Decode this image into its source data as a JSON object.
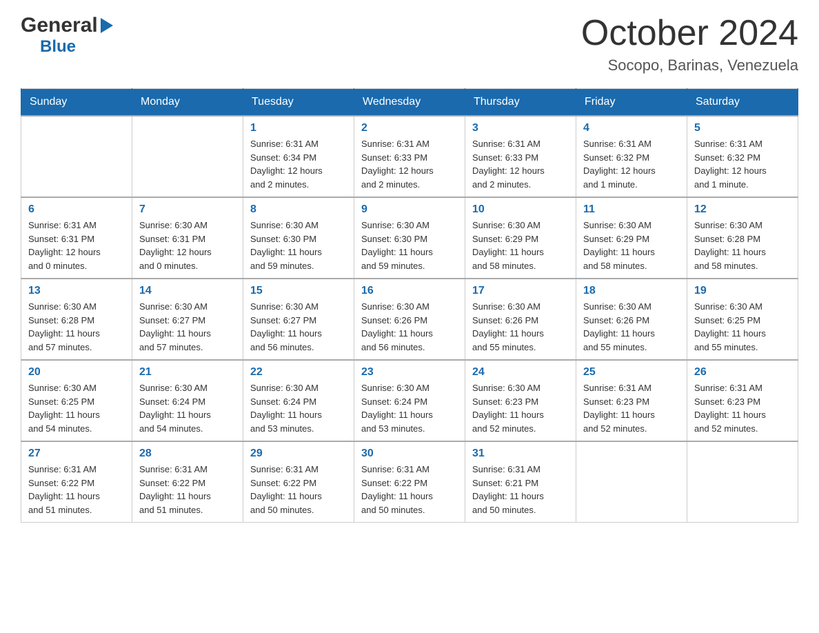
{
  "logo": {
    "general": "General",
    "blue": "Blue",
    "triangle": "▶"
  },
  "title": "October 2024",
  "location": "Socopo, Barinas, Venezuela",
  "weekdays": [
    "Sunday",
    "Monday",
    "Tuesday",
    "Wednesday",
    "Thursday",
    "Friday",
    "Saturday"
  ],
  "weeks": [
    [
      {
        "day": "",
        "info": ""
      },
      {
        "day": "",
        "info": ""
      },
      {
        "day": "1",
        "info": "Sunrise: 6:31 AM\nSunset: 6:34 PM\nDaylight: 12 hours\nand 2 minutes."
      },
      {
        "day": "2",
        "info": "Sunrise: 6:31 AM\nSunset: 6:33 PM\nDaylight: 12 hours\nand 2 minutes."
      },
      {
        "day": "3",
        "info": "Sunrise: 6:31 AM\nSunset: 6:33 PM\nDaylight: 12 hours\nand 2 minutes."
      },
      {
        "day": "4",
        "info": "Sunrise: 6:31 AM\nSunset: 6:32 PM\nDaylight: 12 hours\nand 1 minute."
      },
      {
        "day": "5",
        "info": "Sunrise: 6:31 AM\nSunset: 6:32 PM\nDaylight: 12 hours\nand 1 minute."
      }
    ],
    [
      {
        "day": "6",
        "info": "Sunrise: 6:31 AM\nSunset: 6:31 PM\nDaylight: 12 hours\nand 0 minutes."
      },
      {
        "day": "7",
        "info": "Sunrise: 6:30 AM\nSunset: 6:31 PM\nDaylight: 12 hours\nand 0 minutes."
      },
      {
        "day": "8",
        "info": "Sunrise: 6:30 AM\nSunset: 6:30 PM\nDaylight: 11 hours\nand 59 minutes."
      },
      {
        "day": "9",
        "info": "Sunrise: 6:30 AM\nSunset: 6:30 PM\nDaylight: 11 hours\nand 59 minutes."
      },
      {
        "day": "10",
        "info": "Sunrise: 6:30 AM\nSunset: 6:29 PM\nDaylight: 11 hours\nand 58 minutes."
      },
      {
        "day": "11",
        "info": "Sunrise: 6:30 AM\nSunset: 6:29 PM\nDaylight: 11 hours\nand 58 minutes."
      },
      {
        "day": "12",
        "info": "Sunrise: 6:30 AM\nSunset: 6:28 PM\nDaylight: 11 hours\nand 58 minutes."
      }
    ],
    [
      {
        "day": "13",
        "info": "Sunrise: 6:30 AM\nSunset: 6:28 PM\nDaylight: 11 hours\nand 57 minutes."
      },
      {
        "day": "14",
        "info": "Sunrise: 6:30 AM\nSunset: 6:27 PM\nDaylight: 11 hours\nand 57 minutes."
      },
      {
        "day": "15",
        "info": "Sunrise: 6:30 AM\nSunset: 6:27 PM\nDaylight: 11 hours\nand 56 minutes."
      },
      {
        "day": "16",
        "info": "Sunrise: 6:30 AM\nSunset: 6:26 PM\nDaylight: 11 hours\nand 56 minutes."
      },
      {
        "day": "17",
        "info": "Sunrise: 6:30 AM\nSunset: 6:26 PM\nDaylight: 11 hours\nand 55 minutes."
      },
      {
        "day": "18",
        "info": "Sunrise: 6:30 AM\nSunset: 6:26 PM\nDaylight: 11 hours\nand 55 minutes."
      },
      {
        "day": "19",
        "info": "Sunrise: 6:30 AM\nSunset: 6:25 PM\nDaylight: 11 hours\nand 55 minutes."
      }
    ],
    [
      {
        "day": "20",
        "info": "Sunrise: 6:30 AM\nSunset: 6:25 PM\nDaylight: 11 hours\nand 54 minutes."
      },
      {
        "day": "21",
        "info": "Sunrise: 6:30 AM\nSunset: 6:24 PM\nDaylight: 11 hours\nand 54 minutes."
      },
      {
        "day": "22",
        "info": "Sunrise: 6:30 AM\nSunset: 6:24 PM\nDaylight: 11 hours\nand 53 minutes."
      },
      {
        "day": "23",
        "info": "Sunrise: 6:30 AM\nSunset: 6:24 PM\nDaylight: 11 hours\nand 53 minutes."
      },
      {
        "day": "24",
        "info": "Sunrise: 6:30 AM\nSunset: 6:23 PM\nDaylight: 11 hours\nand 52 minutes."
      },
      {
        "day": "25",
        "info": "Sunrise: 6:31 AM\nSunset: 6:23 PM\nDaylight: 11 hours\nand 52 minutes."
      },
      {
        "day": "26",
        "info": "Sunrise: 6:31 AM\nSunset: 6:23 PM\nDaylight: 11 hours\nand 52 minutes."
      }
    ],
    [
      {
        "day": "27",
        "info": "Sunrise: 6:31 AM\nSunset: 6:22 PM\nDaylight: 11 hours\nand 51 minutes."
      },
      {
        "day": "28",
        "info": "Sunrise: 6:31 AM\nSunset: 6:22 PM\nDaylight: 11 hours\nand 51 minutes."
      },
      {
        "day": "29",
        "info": "Sunrise: 6:31 AM\nSunset: 6:22 PM\nDaylight: 11 hours\nand 50 minutes."
      },
      {
        "day": "30",
        "info": "Sunrise: 6:31 AM\nSunset: 6:22 PM\nDaylight: 11 hours\nand 50 minutes."
      },
      {
        "day": "31",
        "info": "Sunrise: 6:31 AM\nSunset: 6:21 PM\nDaylight: 11 hours\nand 50 minutes."
      },
      {
        "day": "",
        "info": ""
      },
      {
        "day": "",
        "info": ""
      }
    ]
  ]
}
